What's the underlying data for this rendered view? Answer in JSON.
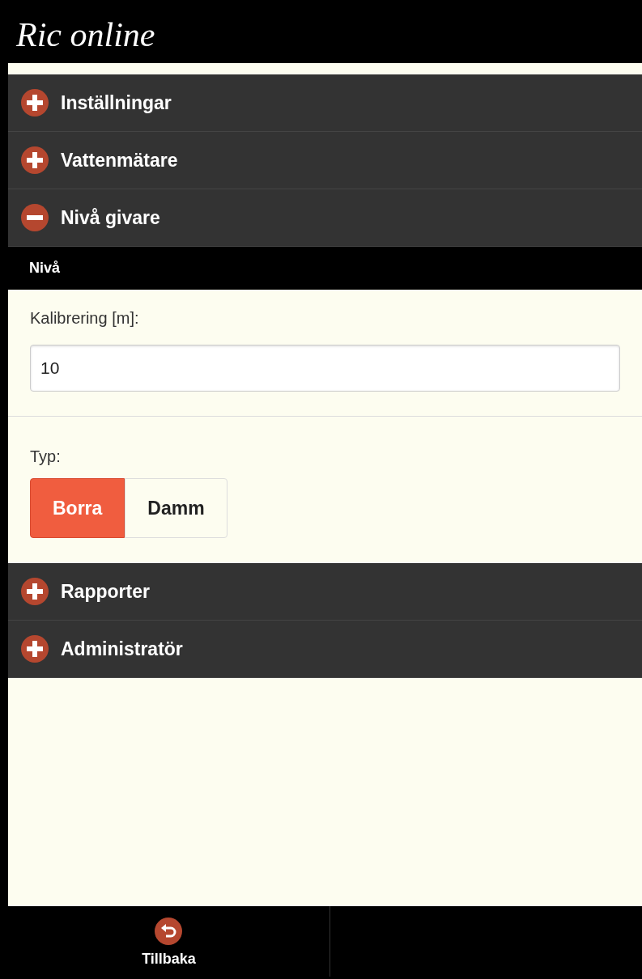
{
  "header": {
    "title": "Ric online"
  },
  "sections": [
    {
      "label": "Inställningar",
      "expanded": false
    },
    {
      "label": "Vattenmätare",
      "expanded": false
    },
    {
      "label": "Nivå givare",
      "expanded": true,
      "content": {
        "subheader": "Nivå",
        "field": {
          "label": "Kalibrering [m]:",
          "value": "10"
        },
        "choice": {
          "label": "Typ:",
          "options": [
            {
              "label": "Borra",
              "selected": true
            },
            {
              "label": "Damm",
              "selected": false
            }
          ]
        }
      }
    },
    {
      "label": "Rapporter",
      "expanded": false
    },
    {
      "label": "Administratör",
      "expanded": false
    }
  ],
  "footer": {
    "buttons": [
      {
        "label": "Tillbaka"
      }
    ]
  }
}
